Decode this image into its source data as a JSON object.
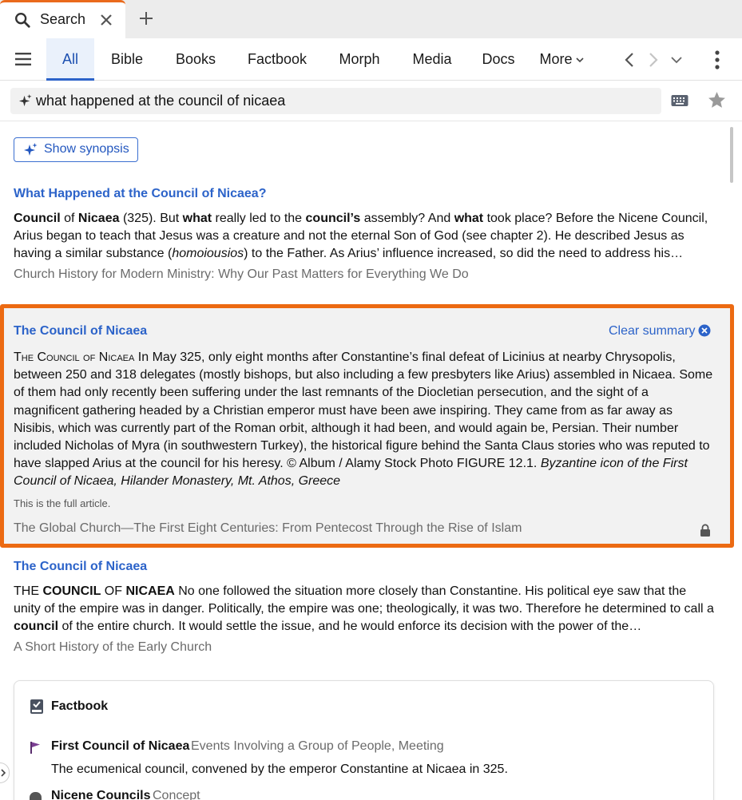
{
  "tab": {
    "label": "Search"
  },
  "nav": {
    "tabs": [
      "All",
      "Bible",
      "Books",
      "Factbook",
      "Morph",
      "Media",
      "Docs"
    ],
    "more_label": "More"
  },
  "search": {
    "query": "what happened at the council of nicaea"
  },
  "synopsis_label": "Show synopsis",
  "results": [
    {
      "title": "What Happened at the Council of Nicaea?",
      "snippet_parts": [
        {
          "t": "Council",
          "b": true
        },
        {
          "t": " of "
        },
        {
          "t": "Nicaea",
          "b": true
        },
        {
          "t": " (325). But "
        },
        {
          "t": "what",
          "b": true
        },
        {
          "t": " really led to the "
        },
        {
          "t": "council’s",
          "b": true
        },
        {
          "t": " assembly? And "
        },
        {
          "t": "what",
          "b": true
        },
        {
          "t": " took place? Before the Nicene Council, Arius began to teach that Jesus was a creature and not the eternal Son of God (see chapter 2). He described Jesus as having a similar substance ("
        },
        {
          "t": "homoiousios",
          "i": true
        },
        {
          "t": ") to the Father. As Arius’ influence increased, so did the need to address his…"
        }
      ],
      "source": "Church History for Modern Ministry: Why Our Past Matters for Everything We Do"
    },
    {
      "title": "The Council of Nicaea",
      "clear_label": "Clear summary",
      "snippet_parts": [
        {
          "t": "The Council of Nicaea",
          "sc": true
        },
        {
          "t": " In May 325, only eight months after Constantine’s final defeat of Licinius at nearby Chrysopolis, between 250 and 318 delegates (mostly bishops, but also including a few presbyters like Arius) assembled in Nicaea. Some of them had only recently been suffering under the last remnants of the Diocletian persecution, and the sight of a magnificent gathering headed by a Christian emperor must have been awe inspiring. They came from as far away as Nisibis, which was currently part of the Roman orbit, although it had been, and would again be, Persian. Their number included Nicholas of Myra (in southwestern Turkey), the historical figure behind the Santa Claus stories who was reputed to have slapped Arius at the council for his heresy. © Album / Alamy Stock Photo FIGURE 12.1. "
        },
        {
          "t": "Byzantine icon of the First Council of Nicaea, Hilander Monastery, Mt. Athos, Greece",
          "i": true
        }
      ],
      "note": "This is the full article.",
      "source": "The Global Church—The First Eight Centuries: From Pentecost Through the Rise of Islam"
    },
    {
      "title": "The Council of Nicaea",
      "snippet_parts": [
        {
          "t": "THE "
        },
        {
          "t": "COUNCIL",
          "b": true
        },
        {
          "t": " OF "
        },
        {
          "t": "NICAEA",
          "b": true
        },
        {
          "t": " No one followed the situation more closely than Constantine. His political eye saw that the unity of the empire was in danger. Politically, the empire was one; theologically, it was two. Therefore he determined to call a "
        },
        {
          "t": "council",
          "b": true
        },
        {
          "t": " of the entire church. It would settle the issue, and he would enforce its decision with the power of the…"
        }
      ],
      "source": "A Short History of the Early Church"
    }
  ],
  "factbook": {
    "title": "Factbook",
    "items": [
      {
        "name": "First Council of Nicaea",
        "type": "Events Involving a Group of People, Meeting",
        "desc": "The ecumenical council, convened by the emperor Constantine at Nicaea in 325."
      },
      {
        "name": "Nicene Councils",
        "type": "Concept"
      }
    ]
  },
  "colors": {
    "accent": "#2c63c9",
    "highlight_border": "#ec6a12",
    "tab_indicator": "#ea6a1c"
  }
}
